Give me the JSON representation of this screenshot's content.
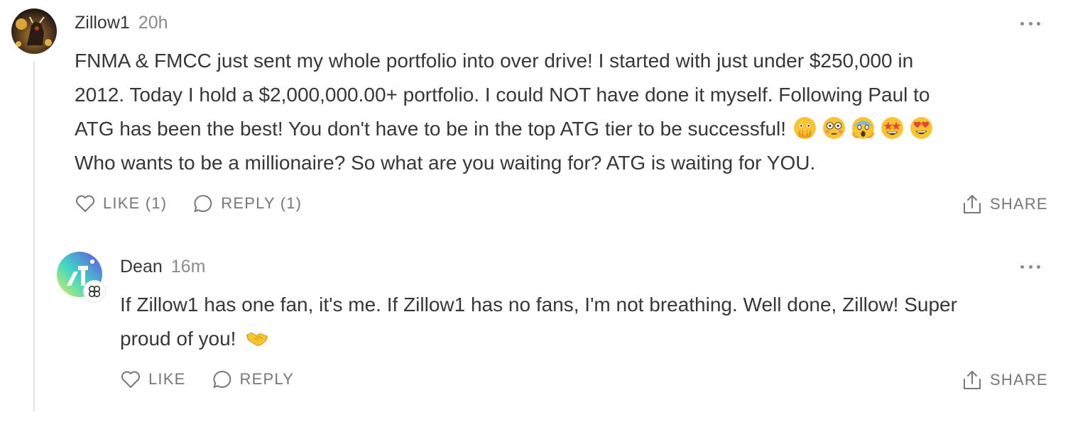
{
  "comment": {
    "author": "Zillow1",
    "time": "20h",
    "lines": [
      "FNMA & FMCC just sent my whole portfolio into over drive! I started with just under $250,000 in",
      "2012. Today I hold a $2,000,000.00+ portfolio. I could NOT have done it myself. Following Paul to",
      "ATG has been the best! You don't have to be in the top ATG tier to be successful!",
      "Who wants to be a millionaire? So what are you waiting for? ATG is waiting for YOU."
    ],
    "emojis": [
      "face-with-open-eyes-and-hand-over-mouth",
      "flushed-face",
      "face-screaming-in-fear",
      "star-struck",
      "smiling-face-with-heart-eyes"
    ],
    "like_label": "LIKE (1)",
    "reply_label": "REPLY (1)",
    "share_label": "SHARE"
  },
  "reply": {
    "author": "Dean",
    "time": "16m",
    "lines": [
      "If Zillow1 has one fan, it's me. If Zillow1 has no fans, I'm not breathing. Well done, Zillow! Super",
      "proud of you!"
    ],
    "emojis": [
      "handshake"
    ],
    "like_label": "LIKE",
    "reply_label": "REPLY",
    "share_label": "SHARE"
  },
  "icons": {
    "like": "heart-icon",
    "reply": "speech-bubble-icon",
    "share": "share-upload-icon",
    "more": "more-horizontal-icon"
  },
  "colors": {
    "text": "#363737",
    "muted": "#8b8b8b",
    "action": "#777777",
    "thread_line": "#e3e3e3"
  }
}
